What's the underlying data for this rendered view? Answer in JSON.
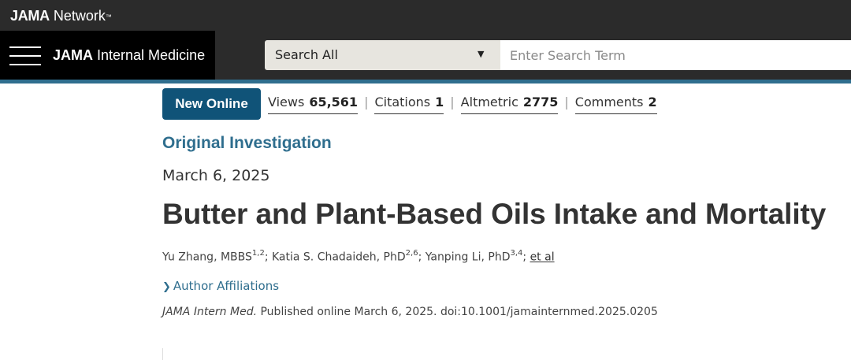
{
  "network": {
    "logo_bold": "JAMA",
    "logo_rest": " Network",
    "tm": "™"
  },
  "header": {
    "journal_bold": "JAMA",
    "journal_rest": " Internal Medicine",
    "search_scope": "Search All",
    "search_placeholder": "Enter Search Term"
  },
  "article": {
    "badge": "New Online",
    "metrics": [
      {
        "label": "Views",
        "value": "65,561"
      },
      {
        "label": "Citations",
        "value": "1"
      },
      {
        "label": "Altmetric",
        "value": "2775"
      },
      {
        "label": "Comments",
        "value": "2"
      }
    ],
    "type": "Original Investigation",
    "date": "March 6, 2025",
    "title": "Butter and Plant-Based Oils Intake and Mortality",
    "authors": [
      {
        "name": "Yu Zhang, MBBS",
        "sup": "1,2"
      },
      {
        "name": "Katia S. Chadaideh, PhD",
        "sup": "2,6"
      },
      {
        "name": "Yanping Li, PhD",
        "sup": "3,4"
      }
    ],
    "et_al": "et al",
    "affiliations_label": "Author Affiliations",
    "journal_abbrev": "JAMA Intern Med.",
    "publication_line": " Published online March 6, 2025. doi:10.1001/jamainternmed.2025.0205"
  }
}
